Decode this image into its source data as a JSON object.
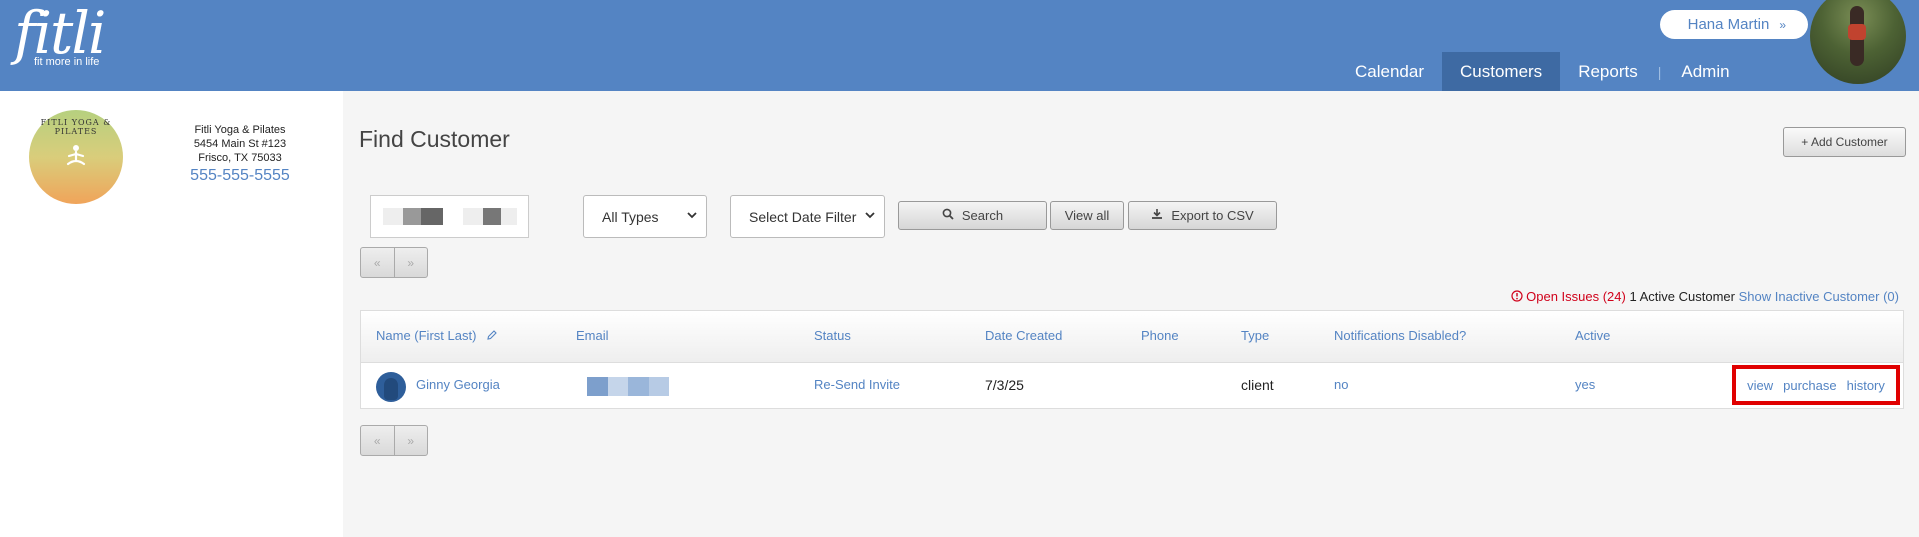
{
  "header": {
    "logo_text": "fitli",
    "logo_tagline": "fit more in life",
    "user_name": "Hana Martin",
    "user_chevron": "»",
    "nav": [
      "Calendar",
      "Customers",
      "Reports",
      "Admin"
    ],
    "nav_separator": "|",
    "active_nav": "Customers",
    "accent": "#5484c3",
    "active_tab_bg": "#3e6aa3"
  },
  "studio": {
    "logo_ring_text": "FITLI YOGA & PILATES",
    "name": "Fitli Yoga & Pilates",
    "address_line1": "5454 Main St #123",
    "address_line2": "Frisco, TX 75033",
    "phone": "555-555-5555"
  },
  "main": {
    "title": "Find Customer",
    "add_button": "+ Add Customer",
    "type_select": "All Types",
    "date_select": "Select Date Filter",
    "search_button": "Search",
    "view_all_button": "View all",
    "export_button": "Export to CSV",
    "pager_prev": "«",
    "pager_next": "»",
    "open_issues": "Open Issues (24)",
    "active_count": "1 Active Customer",
    "show_inactive": "Show Inactive Customer (0)",
    "issues_color": "#d0021b"
  },
  "table": {
    "headers": [
      "Name (First Last)",
      "Email",
      "Status",
      "Date Created",
      "Phone",
      "Type",
      "Notifications Disabled?",
      "Active"
    ],
    "rows": [
      {
        "name": "Ginny Georgia",
        "status": "Re-Send Invite",
        "date_created": "7/3/25",
        "phone": "",
        "type": "client",
        "notifications_disabled": "no",
        "active": "yes",
        "actions": [
          "view",
          "purchase",
          "history"
        ]
      }
    ],
    "highlight_color": "#e00000"
  },
  "icons": {
    "search": "search-icon",
    "download": "download-icon",
    "edit": "pencil-icon",
    "alert": "alert-circle-icon",
    "chevron": "chevron-down-icon"
  }
}
